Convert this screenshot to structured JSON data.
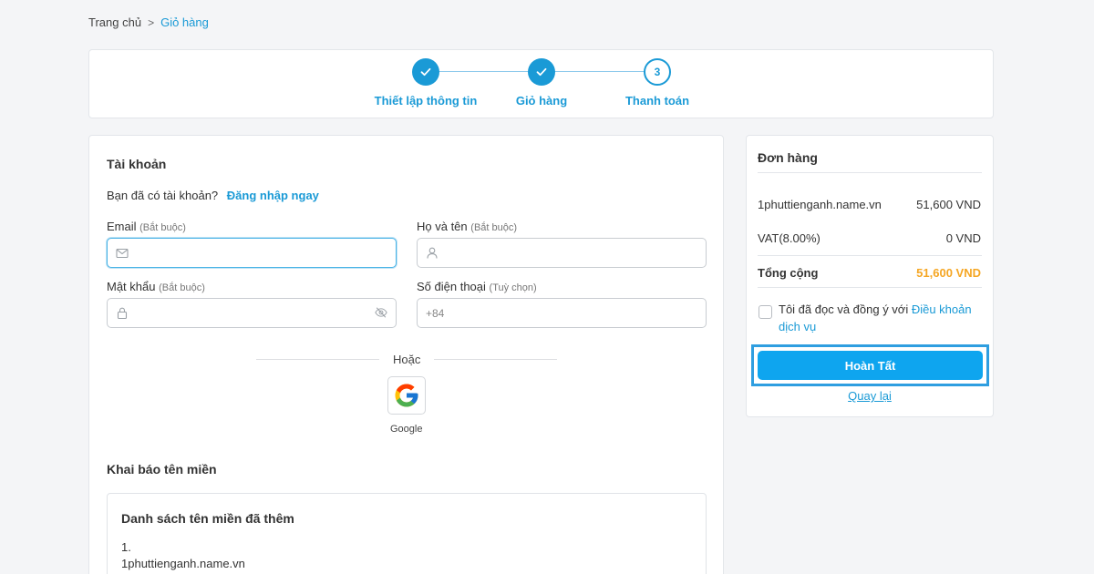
{
  "breadcrumb": {
    "home": "Trang chủ",
    "separator": ">",
    "current": "Giỏ hàng"
  },
  "steps": [
    {
      "label": "Thiết lập thông tin",
      "state": "done"
    },
    {
      "label": "Giỏ hàng",
      "state": "done"
    },
    {
      "label": "Thanh toán",
      "state": "current",
      "number": "3"
    }
  ],
  "account": {
    "title": "Tài khoản",
    "have_account": "Bạn đã có tài khoản?",
    "login_link": "Đăng nhập ngay",
    "email": {
      "label": "Email",
      "hint": "(Bắt buộc)",
      "value": ""
    },
    "fullname": {
      "label": "Họ và tên",
      "hint": "(Bắt buộc)",
      "value": ""
    },
    "password": {
      "label": "Mật khẩu",
      "hint": "(Bắt buộc)",
      "value": ""
    },
    "phone": {
      "label": "Số điện thoại",
      "hint": "(Tuỳ chọn)",
      "placeholder": "+84"
    },
    "or": "Hoặc",
    "google": "Google"
  },
  "domains": {
    "title": "Khai báo tên miền",
    "list_title": "Danh sách tên miền đã thêm",
    "items": [
      {
        "index": "1.",
        "name": "1phuttienganh.name.vn"
      }
    ]
  },
  "order": {
    "title": "Đơn hàng",
    "item_name": "1phuttienganh.name.vn",
    "item_price": "51,600 VND",
    "vat_label": "VAT(8.00%)",
    "vat_value": "0 VND",
    "total_label": "Tổng cộng",
    "total_value": "51,600 VND",
    "terms_text": "Tôi đã đọc và đồng ý với ",
    "terms_link": "Điều khoản dịch vụ",
    "submit": "Hoàn Tất",
    "back": "Quay lại"
  },
  "colors": {
    "accent": "#1a9ad6",
    "button": "#0ea5ef",
    "total": "#f5a623"
  },
  "icons": [
    "check-icon",
    "mail-icon",
    "user-icon",
    "lock-icon",
    "eye-off-icon",
    "google-icon"
  ]
}
